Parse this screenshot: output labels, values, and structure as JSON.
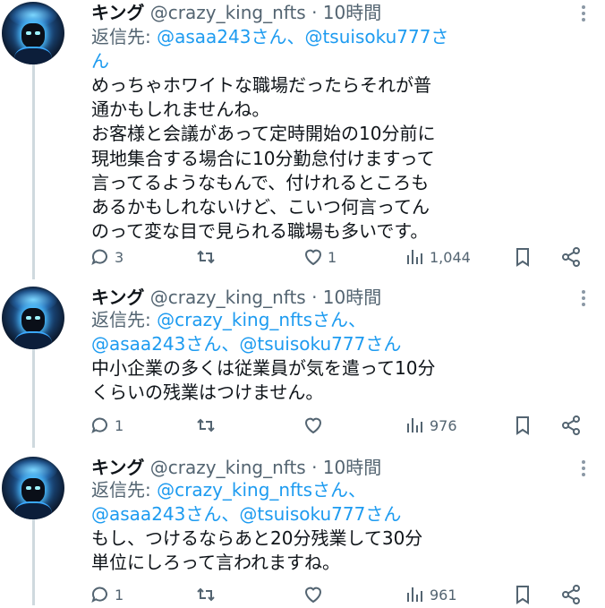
{
  "tweets": [
    {
      "name": "キング",
      "handle": "@crazy_king_nfts",
      "dot": "·",
      "time": "10時間",
      "reply_prefix": "返信先: ",
      "reply_mentions": "@asaa243さん、@tsuisoku777さ\nん",
      "text": "めっちゃホワイトな職場だったらそれが普\n通かもしれませんね。\nお客様と会議があって定時開始の10分前に\n現地集合する場合に10分勤怠付けますって\n言ってるようなもんで、付けれるところも\nあるかもしれないけど、こいつ何言ってん\nのって変な目で見られる職場も多いです。",
      "replies": "3",
      "retweets": "",
      "likes": "1",
      "views": "1,044"
    },
    {
      "name": "キング",
      "handle": "@crazy_king_nfts",
      "dot": "·",
      "time": "10時間",
      "reply_prefix": "返信先: ",
      "reply_mentions": "@crazy_king_nftsさん、\n@asaa243さん、@tsuisoku777さん",
      "text": "中小企業の多くは従業員が気を遣って10分\nくらいの残業はつけません。",
      "replies": "1",
      "retweets": "",
      "likes": "",
      "views": "976"
    },
    {
      "name": "キング",
      "handle": "@crazy_king_nfts",
      "dot": "·",
      "time": "10時間",
      "reply_prefix": "返信先: ",
      "reply_mentions": "@crazy_king_nftsさん、\n@asaa243さん、@tsuisoku777さん",
      "text": "もし、つけるならあと20分残業して30分\n単位にしろって言われますね。",
      "replies": "1",
      "retweets": "",
      "likes": "",
      "views": "961"
    }
  ],
  "icons": {
    "reply": "speech-bubble-icon",
    "retweet": "retweet-arrows-icon",
    "like": "heart-icon",
    "views": "bar-chart-icon",
    "bookmark": "bookmark-icon",
    "share": "share-icon",
    "more": "more-dots-icon"
  },
  "colors": {
    "text": "#0f1419",
    "secondary": "#536471",
    "link": "#1d9bf0",
    "thread_line": "#cfd9de"
  }
}
